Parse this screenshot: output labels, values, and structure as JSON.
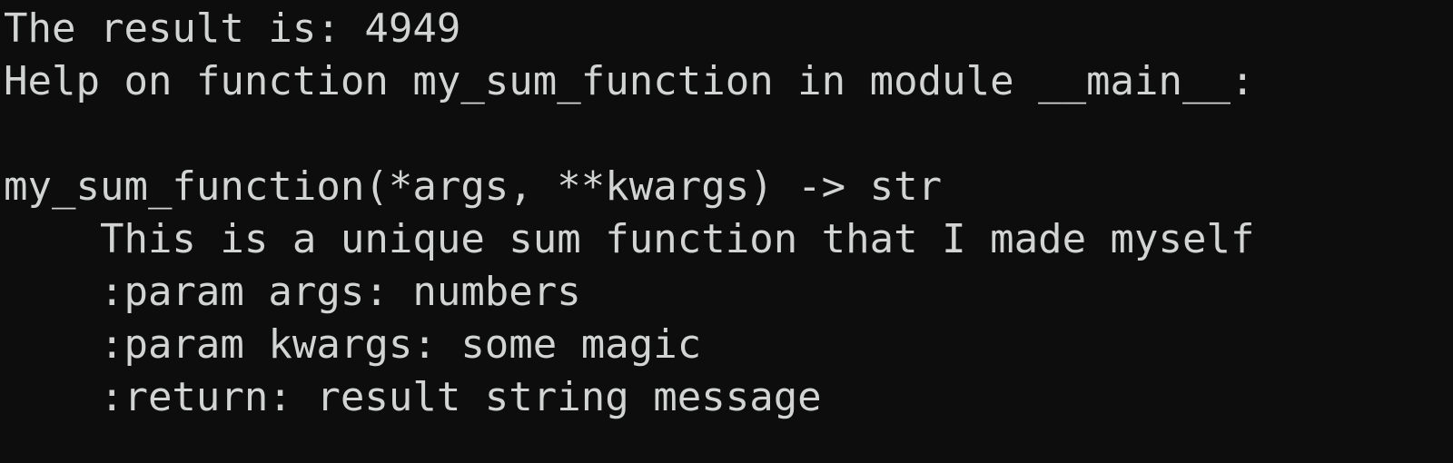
{
  "terminal": {
    "background_color": "#0d0d0d",
    "foreground_color": "#d2d4d3",
    "font_size_px": 44,
    "line_height_px": 58,
    "lines": [
      {
        "id": "result-line",
        "text": "The result is: 4949"
      },
      {
        "id": "help-header-line",
        "text": "Help on function my_sum_function in module __main__:"
      },
      {
        "id": "blank-line",
        "text": ""
      },
      {
        "id": "signature-line",
        "text": "my_sum_function(*args, **kwargs) -> str"
      },
      {
        "id": "docstring-summary-line",
        "text": "    This is a unique sum function that I made myself"
      },
      {
        "id": "docstring-param-args-line",
        "text": "    :param args: numbers"
      },
      {
        "id": "docstring-param-kwargs-line",
        "text": "    :param kwargs: some magic"
      },
      {
        "id": "docstring-return-line",
        "text": "    :return: result string message"
      }
    ],
    "values": {
      "result": "4949",
      "function_name": "my_sum_function",
      "module_name": "__main__",
      "signature": "my_sum_function(*args, **kwargs) -> str",
      "return_type": "str",
      "params": [
        "args",
        "kwargs"
      ]
    }
  }
}
